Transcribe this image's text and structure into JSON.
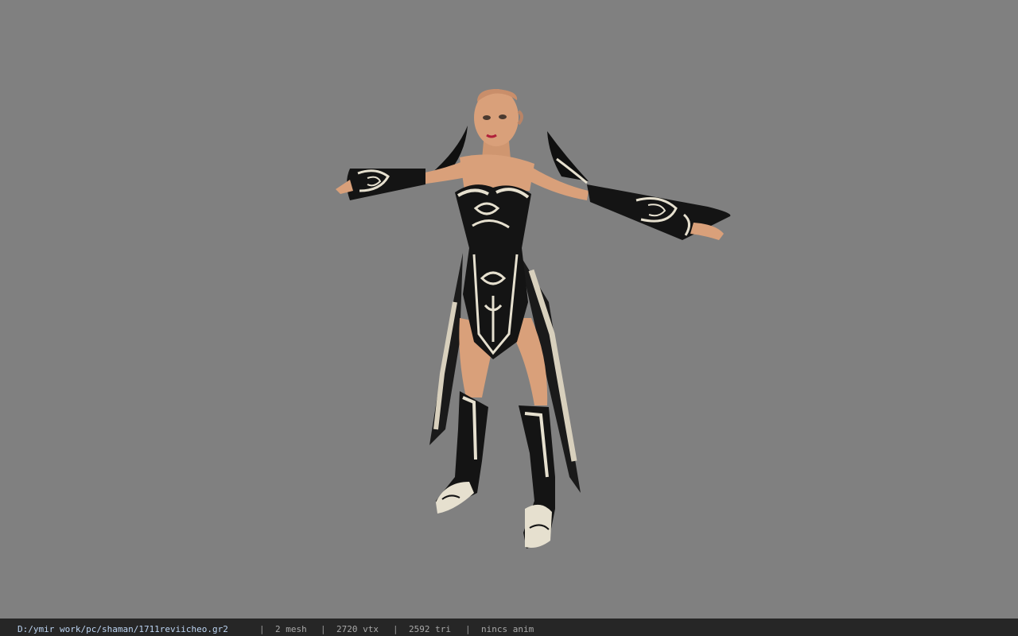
{
  "viewer": {
    "background_color": "#808080"
  },
  "status_bar": {
    "file_path": "D:/ymir work/pc/shaman/1711reviicheo.gr2",
    "separator": "|",
    "mesh_count": "2 mesh",
    "vertex_count": "2720 vtx",
    "triangle_count": "2592 tri",
    "animation": "nincs anim",
    "path_color": "#bcd4f2",
    "background_color": "#262626"
  },
  "model": {
    "subject": "female shaman character in T-pose",
    "outfit_colors": {
      "dress": "#141414",
      "trim": "#e6e0cf",
      "skin": "#d9a07a"
    }
  }
}
